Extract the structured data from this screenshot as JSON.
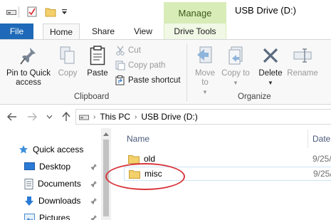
{
  "window": {
    "title": "USB Drive (D:)",
    "context_tab_header": "Manage"
  },
  "ribbon_tabs": {
    "file": "File",
    "home": "Home",
    "share": "Share",
    "view": "View",
    "drive_tools": "Drive Tools"
  },
  "clipboard": {
    "pin_quick_access": "Pin to Quick access",
    "copy": "Copy",
    "paste": "Paste",
    "cut": "Cut",
    "copy_path": "Copy path",
    "paste_shortcut": "Paste shortcut",
    "group_label": "Clipboard"
  },
  "organize": {
    "move_to": "Move to",
    "copy_to": "Copy to",
    "delete": "Delete",
    "rename": "Rename",
    "group_label": "Organize"
  },
  "address": {
    "crumbs": [
      "This PC",
      "USB Drive (D:)"
    ]
  },
  "nav_pane": {
    "items": [
      {
        "label": "Quick access",
        "icon": "star-icon"
      },
      {
        "label": "Desktop",
        "icon": "desktop-folder-icon"
      },
      {
        "label": "Documents",
        "icon": "documents-folder-icon"
      },
      {
        "label": "Downloads",
        "icon": "downloads-folder-icon"
      },
      {
        "label": "Pictures",
        "icon": "pictures-folder-icon"
      }
    ]
  },
  "file_list": {
    "columns": [
      "Name",
      "Date"
    ],
    "rows": [
      {
        "name": "old",
        "date": "9/25/"
      },
      {
        "name": "misc",
        "date": "9/25/"
      }
    ]
  },
  "colors": {
    "file_tab": "#1e6ab8",
    "manage_tab": "#d8ecb8",
    "highlight": "#d9363e",
    "folder": "#f3d06b"
  }
}
